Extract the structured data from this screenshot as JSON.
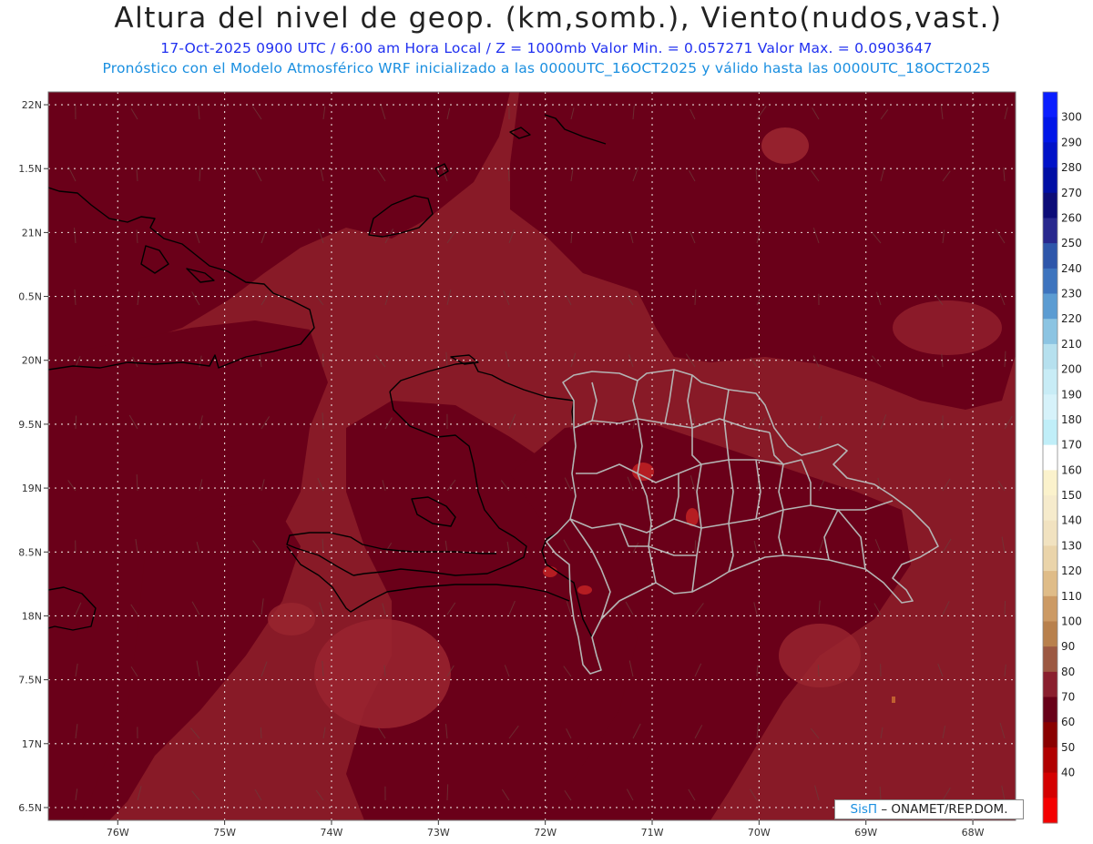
{
  "header": {
    "title": "Altura del nivel de geop. (km,somb.), Viento(nudos,vast.)",
    "line1": "17-Oct-2025  0900 UTC / 6:00 am Hora Local / Z = 1000mb  Valor Min. = 0.057271   Valor Max. = 0.0903647",
    "line2": "Pronóstico con el Modelo Atmosférico WRF inicializado a las 0000UTC_16OCT2025 y válido hasta las  0000UTC_18OCT2025"
  },
  "map": {
    "lat_range": [
      16.4,
      22.1
    ],
    "lon_range": [
      -76.65,
      -67.6
    ],
    "lat_ticks": [
      {
        "value": 22.0,
        "label": "22N"
      },
      {
        "value": 21.5,
        "label": "1.5N"
      },
      {
        "value": 21.0,
        "label": "21N"
      },
      {
        "value": 20.5,
        "label": "0.5N"
      },
      {
        "value": 20.0,
        "label": "20N"
      },
      {
        "value": 19.5,
        "label": "9.5N"
      },
      {
        "value": 19.0,
        "label": "19N"
      },
      {
        "value": 18.5,
        "label": "8.5N"
      },
      {
        "value": 18.0,
        "label": "18N"
      },
      {
        "value": 17.5,
        "label": "7.5N"
      },
      {
        "value": 17.0,
        "label": "17N"
      },
      {
        "value": 16.5,
        "label": "6.5N"
      }
    ],
    "lon_ticks": [
      {
        "value": -76,
        "label": "76W"
      },
      {
        "value": -75,
        "label": "75W"
      },
      {
        "value": -74,
        "label": "74W"
      },
      {
        "value": -73,
        "label": "73W"
      },
      {
        "value": -72,
        "label": "72W"
      },
      {
        "value": -71,
        "label": "71W"
      },
      {
        "value": -70,
        "label": "70W"
      },
      {
        "value": -69,
        "label": "69W"
      },
      {
        "value": -68,
        "label": "68W"
      }
    ],
    "field_colors": {
      "dark": "#6a0019",
      "mid": "#881a27",
      "light": "#9a2530",
      "hot": "#b51d22"
    }
  },
  "colorbar": {
    "levels": [
      {
        "label": "",
        "color": "#0a1eff"
      },
      {
        "label": "300",
        "color": "#0016e8"
      },
      {
        "label": "290",
        "color": "#0012c8"
      },
      {
        "label": "280",
        "color": "#000ea4"
      },
      {
        "label": "270",
        "color": "#0c0c78"
      },
      {
        "label": "260",
        "color": "#28288e"
      },
      {
        "label": "250",
        "color": "#2e56aa"
      },
      {
        "label": "240",
        "color": "#3e74be"
      },
      {
        "label": "230",
        "color": "#5c9cd2"
      },
      {
        "label": "220",
        "color": "#8cc4e2"
      },
      {
        "label": "210",
        "color": "#b6e0ee"
      },
      {
        "label": "200",
        "color": "#c8ecf6"
      },
      {
        "label": "190",
        "color": "#d6f2fa"
      },
      {
        "label": "180",
        "color": "#c0eef8"
      },
      {
        "label": "170",
        "color": "#ffffff"
      },
      {
        "label": "160",
        "color": "#fbf2cc"
      },
      {
        "label": "150",
        "color": "#f6ebcc"
      },
      {
        "label": "140",
        "color": "#f1e2c0"
      },
      {
        "label": "130",
        "color": "#ead4aa"
      },
      {
        "label": "120",
        "color": "#dfbc88"
      },
      {
        "label": "110",
        "color": "#cc9a64"
      },
      {
        "label": "100",
        "color": "#b8804c"
      },
      {
        "label": "90",
        "color": "#9c5842"
      },
      {
        "label": "80",
        "color": "#8a1f2e"
      },
      {
        "label": "70",
        "color": "#680018"
      },
      {
        "label": "60",
        "color": "#8a0000"
      },
      {
        "label": "50",
        "color": "#b00000"
      },
      {
        "label": "40",
        "color": "#d40000"
      },
      {
        "label": "",
        "color": "#f40000"
      }
    ]
  },
  "credit": {
    "sis": "SisΠ",
    "separator": "–",
    "org": "ONAMET/REP.DOM."
  }
}
